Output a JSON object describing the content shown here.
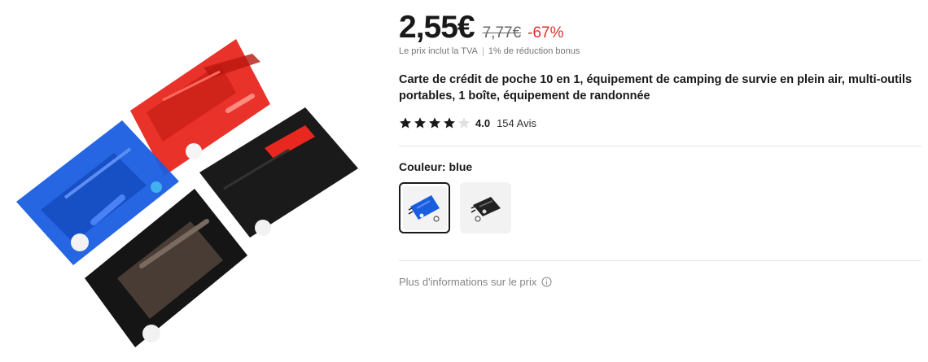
{
  "product": {
    "image_icon": "product-photo-card-tools",
    "price": {
      "current": "2,55€",
      "original": "7,77€",
      "discount": "-67%"
    },
    "tax": {
      "vat_note": "Le prix inclut la TVA",
      "bonus_note": "1% de réduction bonus"
    },
    "title": "Carte de crédit de poche 10 en 1, équipement de camping de survie en plein air, multi-outils portables, 1 boîte, équipement de randonnée",
    "rating": {
      "value": "4.0",
      "stars": 4,
      "max": 5,
      "reviews": "154 Avis"
    },
    "color": {
      "label": "Couleur: blue",
      "options": [
        {
          "name": "blue",
          "selected": true,
          "icon": "blue-card-thumbnail"
        },
        {
          "name": "black",
          "selected": false,
          "icon": "black-card-thumbnail"
        }
      ]
    },
    "more_info": {
      "label": "Plus d'informations sur le prix",
      "icon": "info-icon"
    }
  },
  "colors": {
    "text": "#191919",
    "discount": "#e0302a",
    "muted": "#757575",
    "card_red": "#e8271e",
    "card_blue": "#1a5ee0",
    "card_black": "#1a1a1a"
  }
}
